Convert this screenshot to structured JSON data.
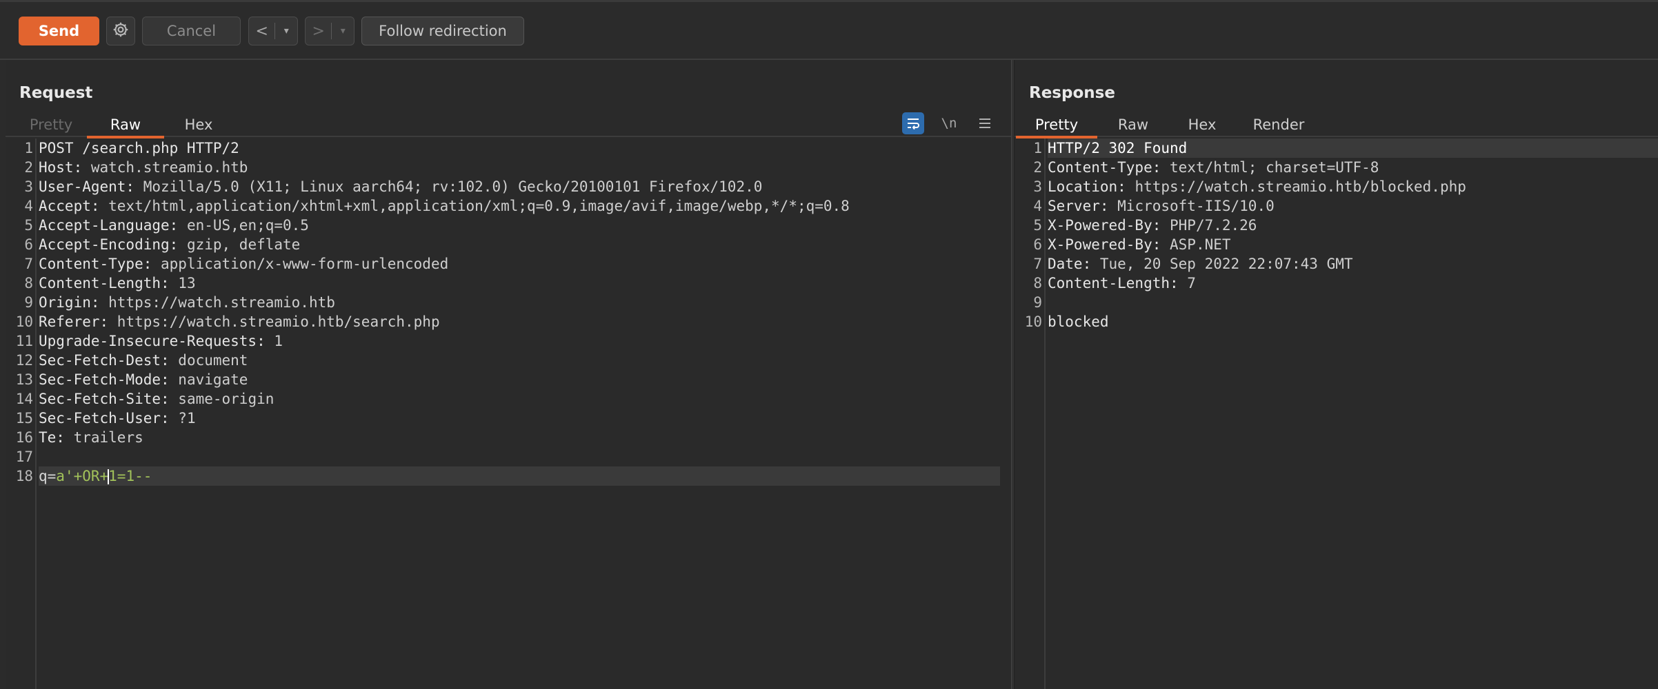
{
  "toolbar": {
    "send_label": "Send",
    "settings_icon": "gear-icon",
    "cancel_label": "Cancel",
    "back_arrow": "<",
    "back_caret": "▾",
    "forward_arrow": ">",
    "forward_caret": "▾",
    "follow_label": "Follow redirection"
  },
  "request": {
    "title": "Request",
    "tabs": [
      "Pretty",
      "Raw",
      "Hex"
    ],
    "active_tab": "Raw",
    "icons": [
      "wrap-lines-icon",
      "newline-icon",
      "menu-icon"
    ],
    "newline_label": "\\n",
    "lines": [
      {
        "n": "1",
        "name": "POST /search.php HTTP/2",
        "value": ""
      },
      {
        "n": "2",
        "name": "Host:",
        "value": " watch.streamio.htb"
      },
      {
        "n": "3",
        "name": "User-Agent:",
        "value": " Mozilla/5.0 (X11; Linux aarch64; rv:102.0) Gecko/20100101 Firefox/102.0"
      },
      {
        "n": "4",
        "name": "Accept:",
        "value": " text/html,application/xhtml+xml,application/xml;q=0.9,image/avif,image/webp,*/*;q=0.8"
      },
      {
        "n": "5",
        "name": "Accept-Language:",
        "value": " en-US,en;q=0.5"
      },
      {
        "n": "6",
        "name": "Accept-Encoding:",
        "value": " gzip, deflate"
      },
      {
        "n": "7",
        "name": "Content-Type:",
        "value": " application/x-www-form-urlencoded"
      },
      {
        "n": "8",
        "name": "Content-Length:",
        "value": " 13"
      },
      {
        "n": "9",
        "name": "Origin:",
        "value": " https://watch.streamio.htb"
      },
      {
        "n": "10",
        "name": "Referer:",
        "value": " https://watch.streamio.htb/search.php"
      },
      {
        "n": "11",
        "name": "Upgrade-Insecure-Requests:",
        "value": " 1"
      },
      {
        "n": "12",
        "name": "Sec-Fetch-Dest:",
        "value": " document"
      },
      {
        "n": "13",
        "name": "Sec-Fetch-Mode:",
        "value": " navigate"
      },
      {
        "n": "14",
        "name": "Sec-Fetch-Site:",
        "value": " same-origin"
      },
      {
        "n": "15",
        "name": "Sec-Fetch-User:",
        "value": " ?1"
      },
      {
        "n": "16",
        "name": "Te:",
        "value": " trailers"
      },
      {
        "n": "17",
        "name": "",
        "value": ""
      }
    ],
    "body_line": {
      "n": "18",
      "param": "q=",
      "value_before_cursor": "a'+OR+",
      "value_after_cursor": "1=1--"
    }
  },
  "response": {
    "title": "Response",
    "tabs": [
      "Pretty",
      "Raw",
      "Hex",
      "Render"
    ],
    "active_tab": "Pretty",
    "lines": [
      {
        "n": "1",
        "name": "HTTP/2 302 Found",
        "value": ""
      },
      {
        "n": "2",
        "name": "Content-Type:",
        "value": " text/html; charset=UTF-8"
      },
      {
        "n": "3",
        "name": "Location:",
        "value": " https://watch.streamio.htb/blocked.php"
      },
      {
        "n": "4",
        "name": "Server:",
        "value": " Microsoft-IIS/10.0"
      },
      {
        "n": "5",
        "name": "X-Powered-By:",
        "value": " PHP/7.2.26"
      },
      {
        "n": "6",
        "name": "X-Powered-By:",
        "value": " ASP.NET"
      },
      {
        "n": "7",
        "name": "Date:",
        "value": " Tue, 20 Sep 2022 22:07:43 GMT"
      },
      {
        "n": "8",
        "name": "Content-Length:",
        "value": " 7"
      },
      {
        "n": "9",
        "name": "",
        "value": ""
      },
      {
        "n": "10",
        "name": "blocked",
        "value": ""
      }
    ]
  },
  "colors": {
    "accent": "#e2642f",
    "param_value": "#a2c25a",
    "wrap_icon_bg": "#2d6cae"
  }
}
